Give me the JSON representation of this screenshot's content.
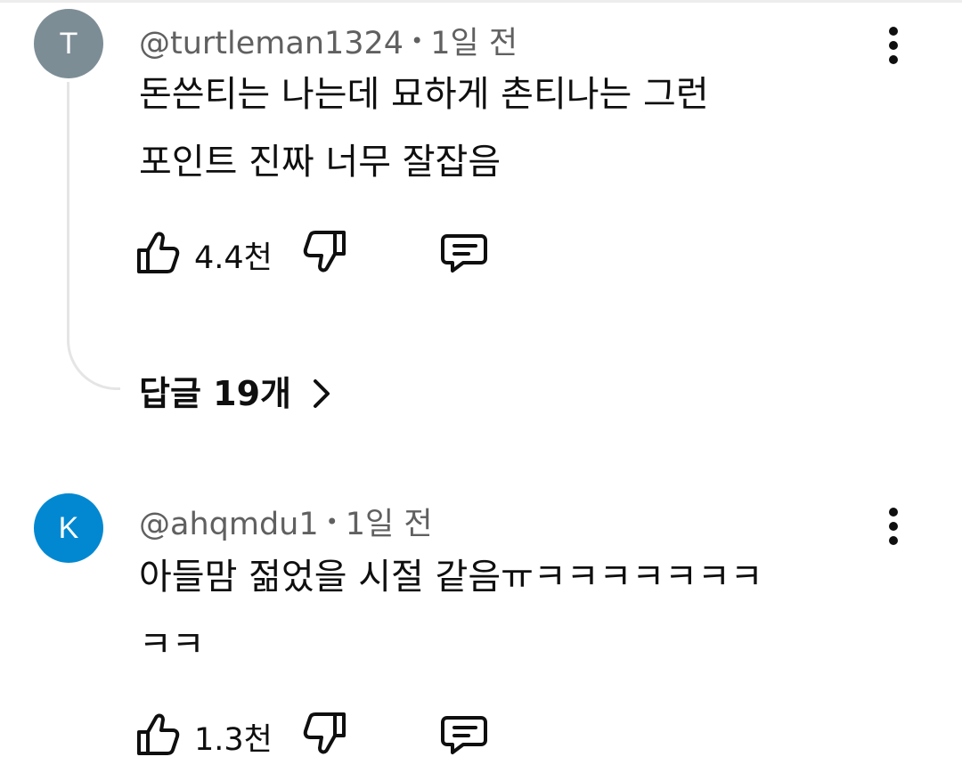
{
  "comments": [
    {
      "avatar_letter": "T",
      "avatar_color": "#7d8d96",
      "handle": "@turtleman1324",
      "separator": "•",
      "time": "1일 전",
      "text": "돈쓴티는 나는데 묘하게 촌티나는 그런\n포인트 진짜 너무 잘잡음",
      "likes": "4.4천",
      "replies_label": "답글 19개"
    },
    {
      "avatar_letter": "K",
      "avatar_color": "#0288d1",
      "handle": "@ahqmdu1",
      "separator": "•",
      "time": "1일 전",
      "text": "아들맘 젊었을 시절 같음ㅠㅋㅋㅋㅋㅋㅋㅋ\nㅋㅋ",
      "likes": "1.3천"
    }
  ],
  "icons": {
    "like": "thumbs-up-icon",
    "dislike": "thumbs-down-icon",
    "reply": "comment-reply-icon",
    "more": "more-vertical-icon",
    "chevron": "chevron-right-icon"
  }
}
